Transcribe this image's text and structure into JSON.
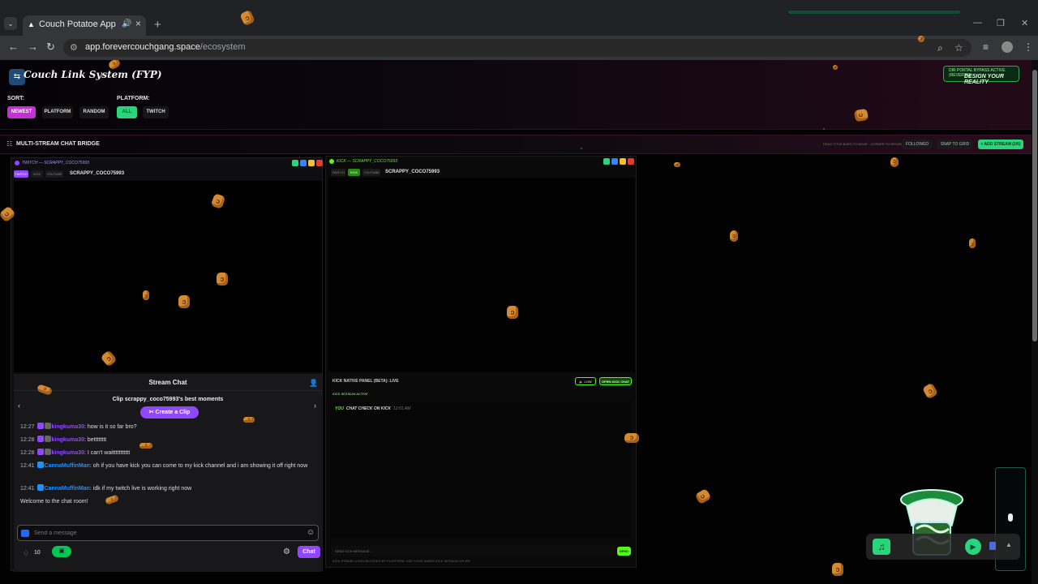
{
  "browser": {
    "tab_title": "Couch Potatoe App",
    "url_host": "app.forevercouchgang.space",
    "url_path": "/ecosystem"
  },
  "header": {
    "title": "Couch Link System (FYP)",
    "portal_status": "DIR PORTAL BYPASS ACTIVE (REVERSE)",
    "tagline": "DESIGN YOUR REALITY"
  },
  "filters": {
    "sort_label": "SORT:",
    "sort_options": [
      "NEWEST",
      "PLATFORM",
      "RANDOM"
    ],
    "platform_label": "PLATFORM:",
    "platform_options": [
      "ALL",
      "TWITCH"
    ]
  },
  "bridge": {
    "title": "MULTI-STREAM CHAT BRIDGE",
    "hint": "DRAG TITLE BARS TO MOVE · CORNER TO RESIZE",
    "followed": "FOLLOWED",
    "snap": "SNAP TO GRID",
    "add_stream": "+ ADD STREAM (2/6)"
  },
  "twitch_panel": {
    "title": "TWITCH — SCRAPPY_COCO75993",
    "tabs": [
      "TWITCH",
      "KICK",
      "YOUTUBE"
    ],
    "channel": "SCRAPPY_COCO75993",
    "chat": {
      "header": "Stream Chat",
      "clip_title": "Clip scrappy_coco75993's best moments",
      "create_clip": "Create a Clip",
      "messages": [
        {
          "time": "12:27",
          "user": "kingkuma30",
          "text": ": how is it so far bro?"
        },
        {
          "time": "12:28",
          "user": "kingkuma30",
          "text": ": betttttttt"
        },
        {
          "time": "12:28",
          "user": "kingkuma30",
          "text": ": I can't waittttttttttt"
        },
        {
          "time": "12:41",
          "user": "CannaMuffinMan",
          "text": ": oh if you have kick you can come to my kick channel and i am showing it off right now"
        },
        {
          "time": "12:41",
          "user": "CannaMuffinMan",
          "text": ": idk if my twitch live is working right now"
        }
      ],
      "welcome": "Welcome to the chat room!",
      "input_placeholder": "Send a message",
      "points": "10",
      "chat_button": "Chat"
    }
  },
  "kick_panel": {
    "title": "KICK — SCRAPPY_COCO75993",
    "tabs": [
      "TWITCH",
      "KICK",
      "YOUTUBE"
    ],
    "channel": "SCRAPPY_COCO75993",
    "chat_title": "KICK NATIVE PANEL (BETA): LIVE",
    "low_btn": "LOW",
    "open_btn": "OPEN KICK CHAT",
    "session": "KICK SESSION ACTIVE",
    "message_you": "YOU",
    "message_text": "CHAT CHECK ON KICK",
    "message_time": "12:01 AM",
    "input_placeholder": "SEND KICK MESSAGE...",
    "send": "SEND",
    "footnote": "KICK IFRAME LOGIN BLOCKED BY PLATFORM. USE YOUR SAVED KICK SESSION OR API."
  },
  "colors": {
    "twitch": "#9147ff",
    "kick": "#53fc18",
    "accent_magenta": "#c42fd6",
    "accent_green": "#2ad47a"
  }
}
